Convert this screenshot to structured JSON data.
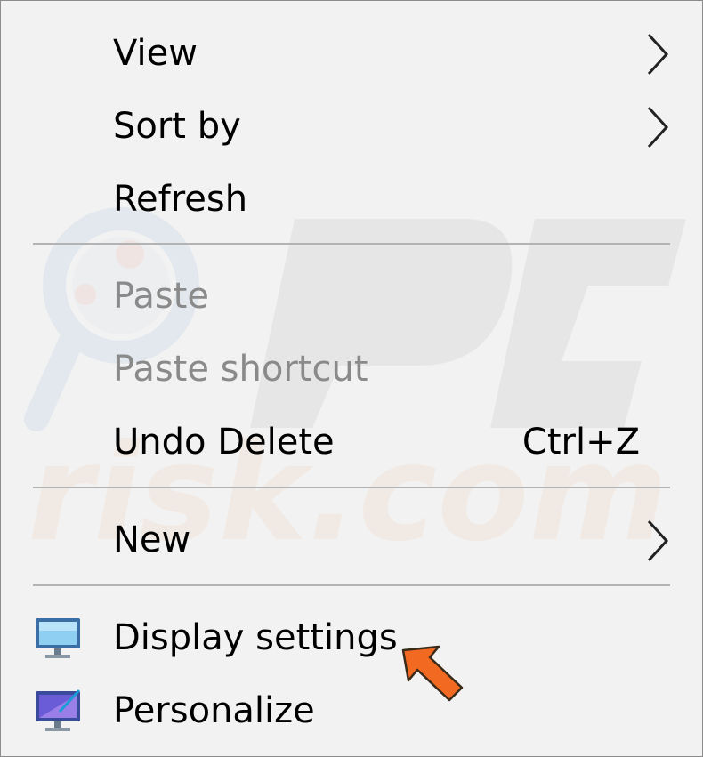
{
  "context_menu": {
    "items": [
      {
        "label": "View",
        "has_submenu": true,
        "disabled": false
      },
      {
        "label": "Sort by",
        "has_submenu": true,
        "disabled": false
      },
      {
        "label": "Refresh",
        "has_submenu": false,
        "disabled": false
      },
      {
        "label": "Paste",
        "has_submenu": false,
        "disabled": true
      },
      {
        "label": "Paste shortcut",
        "has_submenu": false,
        "disabled": true
      },
      {
        "label": "Undo Delete",
        "shortcut": "Ctrl+Z",
        "has_submenu": false,
        "disabled": false
      },
      {
        "label": "New",
        "has_submenu": true,
        "disabled": false
      },
      {
        "label": "Display settings",
        "icon": "display-monitor-icon",
        "has_submenu": false,
        "disabled": false
      },
      {
        "label": "Personalize",
        "icon": "personalize-monitor-icon",
        "has_submenu": false,
        "disabled": false
      }
    ]
  },
  "annotation": {
    "icon": "orange-pointer-arrow-icon",
    "color": "#f26a21",
    "points_to": "Display settings"
  },
  "colors": {
    "menu_background": "#f2f2f2",
    "disabled_text": "#8a8a8a",
    "separator": "#b3b3b3",
    "border": "#8c8c8c"
  }
}
